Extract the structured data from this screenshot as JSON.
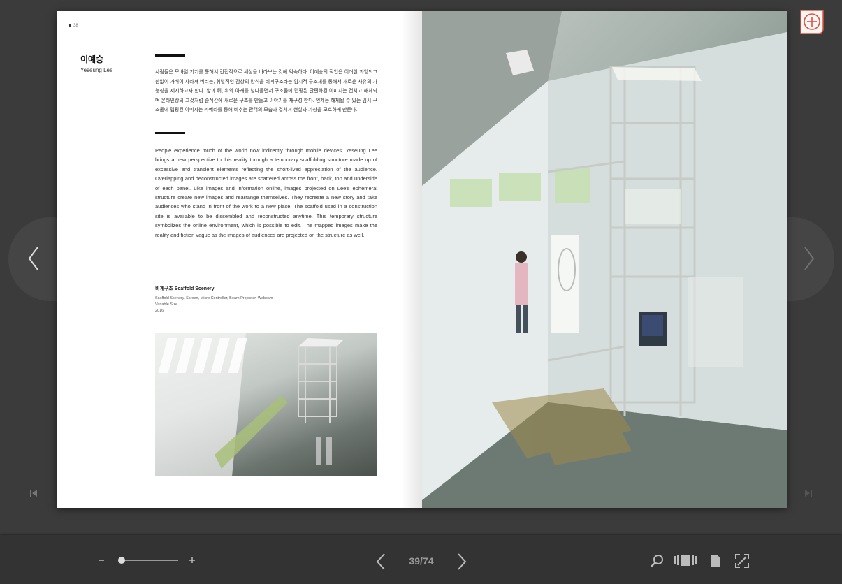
{
  "page": {
    "number": "38",
    "artist_name_kr": "이예승",
    "artist_name_en": "Yeseung Lee",
    "description_kr": "사람들은 모바일 기기를 통해서 간접적으로 세상을 바라보는 것에 익숙하다. 이예승의 작업은 이러한 과잉되고 한없이 가벼이 사라져 버리는, 휘발적인 감상의 방식을 비계구조라는 임시적 구조체를 통해서 새로운 사유의 가능성을 제시하고자 한다. 앞과 뒤, 위와 아래를 넘나들면서 구조물에 맵핑된 단편화된 이미지는 겹치고 해체되며 온라인상의 그것처럼 순식간에 새로운 구조를 만들고 이야기를 재구성 한다. 언제든 해체될 수 있는 임시 구조물에 맵핑된 이미지는 카메라를 통해 비추는 관객의 모습과 겹쳐져 현실과 가상을 모호하게 만든다.",
    "description_en": "People experience much of the world now indirectly through mobile devices. Yeseung Lee brings a new perspective to this reality through a temporary scaffolding structure made up of excessive and transient elements reflecting the short-lived appreciation of the audience. Overlapping and deconstructed images are scattered across the front, back, top and underside of each panel. Like images and information online, images projected on Lee's ephemeral structure create new images and rearrange themselves. They recreate a new story and take audiences who stand in front of the work to a new place. The scaffold used in a construction site is available to be dissembled and reconstructed anytime. This temporary structure symbolizes the online environment, which is possible to edit. The mapped images make the reality and fiction vague as the images of audiences are projected on the structure as well.",
    "work_title": "비계구조 Scaffold Scenery",
    "work_materials": "Scaffold Scenery, Screen, Micro Controller, Beam Projector, Webcam",
    "work_size": "Variable Size",
    "work_year": "2016"
  },
  "toolbar": {
    "page_counter": "39/74",
    "zoom_level": 0.05
  },
  "icons": {
    "bookmark": "bookmark-add-icon",
    "prev": "chevron-left-icon",
    "next": "chevron-right-icon",
    "first": "skip-first-icon",
    "last": "skip-last-icon",
    "zoom_out": "minus-icon",
    "zoom_in": "plus-icon",
    "search": "search-icon",
    "thumbnails": "thumbnails-icon",
    "single_page": "single-page-icon",
    "fullscreen": "fullscreen-icon"
  },
  "colors": {
    "background": "#3b3b3b",
    "toolbar": "#333333",
    "bookmark_accent": "#e0533c"
  }
}
